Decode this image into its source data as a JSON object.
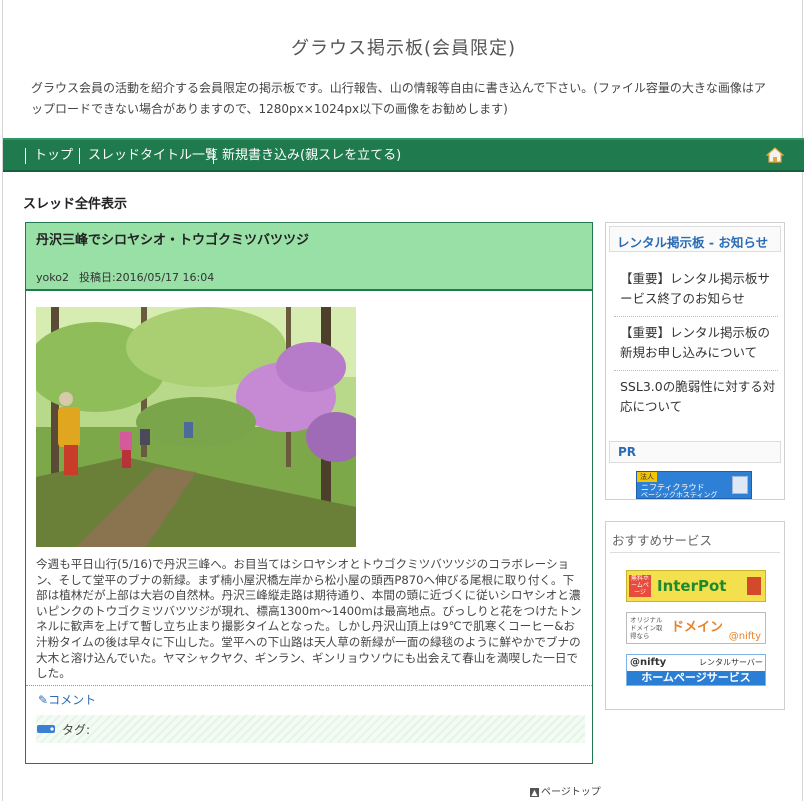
{
  "site": {
    "title": "グラウス掲示板(会員限定)",
    "description": "グラウス会員の活動を紹介する会員限定の掲示板です。山行報告、山の情報等自由に書き込んで下さい。(ファイル容量の大きな画像はアップロードできない場合がありますので、1280px×1024px以下の画像をお勧めします)"
  },
  "nav": {
    "items": [
      "トップ",
      "スレッドタイトル一覧",
      "新規書き込み(親スレを立てる)"
    ],
    "home_icon": "home-icon"
  },
  "section_heading": "スレッド全件表示",
  "post": {
    "title": "丹沢三峰でシロヤシオ・トウゴクミツバツツジ",
    "author": "yoko2",
    "date": "投稿日:2016/05/17 16:04",
    "body": "今週も平日山行(5/16)で丹沢三峰へ。お目当てはシロヤシオとトウゴクミツバツツジのコラボレーション、そして堂平のブナの新緑。まず楠小屋沢橋左岸から松小屋の頭西P870へ伸びる尾根に取り付く。下部は植林だが上部は大岩の自然林。丹沢三峰縦走路は期待通り、本間の頭に近づくに従いシロヤシオと濃いピンクのトウゴクミツバツツジが現れ、標高1300m〜1400mは最高地点。びっしりと花をつけたトンネルに歓声を上げて暫し立ち止まり撮影タイムとなった。しかし丹沢山頂上は9℃で肌寒くコーヒー&お汁粉タイムの後は早々に下山した。堂平への下山路は天人草の新緑が一面の緑毯のように鮮やかでブナの大木と溶け込んでいた。ヤマシャクヤク、ギンラン、ギンリョウソウにも出会えて春山を満喫した一日でした。",
    "comment_label": "コメント",
    "tag_label": "タグ:"
  },
  "page_top": "ページトップ",
  "sidebar": {
    "notice_heading": "レンタル掲示板 - お知らせ",
    "notices": [
      "【重要】レンタル掲示板サービス終了のお知らせ",
      "【重要】レンタル掲示板の新規お申し込みについて",
      "SSL3.0の脆弱性に対する対応について"
    ],
    "pr_heading": "PR",
    "pr_banner": {
      "line1": "ニフティクラウド",
      "line2": "ベーシックホスティング",
      "tag": "法人"
    },
    "recommend_heading": "おすすめサービス",
    "banners": [
      {
        "label": "InterPot",
        "sub": "無料ホームページ"
      },
      {
        "label": "ドメイン",
        "sub": "オリジナルドメイン取得なら",
        "brand": "@nifty"
      },
      {
        "label": "ホームページサービス",
        "sub": "レンタルサーバー",
        "brand": "@nifty"
      }
    ]
  },
  "colors": {
    "nav_bg": "#1f7a4d",
    "post_header_bg": "#99e0a6",
    "link": "#2a6db5"
  }
}
